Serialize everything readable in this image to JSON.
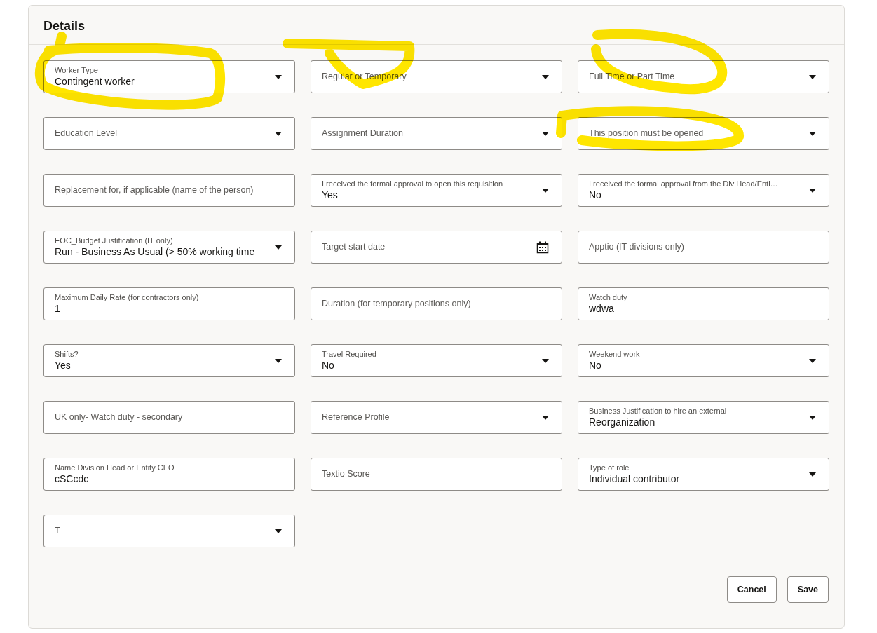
{
  "section": {
    "title": "Details"
  },
  "fields": [
    {
      "kind": "select",
      "label": "Worker Type",
      "value": "Contingent worker"
    },
    {
      "kind": "select",
      "label": "Regular or Temporary"
    },
    {
      "kind": "select",
      "label": "Full Time or Part Time"
    },
    {
      "kind": "select",
      "label": "Education Level"
    },
    {
      "kind": "select",
      "label": "Assignment Duration"
    },
    {
      "kind": "select",
      "label": "This position must be opened"
    },
    {
      "kind": "text",
      "label": "Replacement for, if applicable (name of the person)"
    },
    {
      "kind": "select",
      "label": "I received the formal approval to open this requisition",
      "value": "Yes"
    },
    {
      "kind": "select",
      "label": "I received the formal approval from the Div Head/Enti…",
      "value": "No"
    },
    {
      "kind": "select",
      "label": "EOC_Budget Justification (IT only)",
      "value": "Run - Business As Usual (> 50% working time"
    },
    {
      "kind": "date",
      "label": "Target start date"
    },
    {
      "kind": "text",
      "label": "Apptio (IT divisions only)"
    },
    {
      "kind": "text",
      "label": "Maximum Daily Rate (for contractors only)",
      "value": "1"
    },
    {
      "kind": "text",
      "label": "Duration (for temporary positions only)"
    },
    {
      "kind": "text",
      "label": "Watch duty",
      "value": "wdwa"
    },
    {
      "kind": "select",
      "label": "Shifts?",
      "value": "Yes"
    },
    {
      "kind": "select",
      "label": "Travel Required",
      "value": "No"
    },
    {
      "kind": "select",
      "label": "Weekend work",
      "value": "No"
    },
    {
      "kind": "text",
      "label": "UK only- Watch duty - secondary"
    },
    {
      "kind": "select",
      "label": "Reference Profile"
    },
    {
      "kind": "select",
      "label": "Business Justification to hire an external",
      "value": "Reorganization"
    },
    {
      "kind": "text",
      "label": "Name Division Head or Entity CEO",
      "value": "cSCcdc"
    },
    {
      "kind": "text",
      "label": "Textio Score"
    },
    {
      "kind": "select",
      "label": "Type of role",
      "value": "Individual contributor"
    },
    {
      "kind": "select",
      "label": "T"
    }
  ],
  "buttons": [
    "Cancel",
    "Save"
  ]
}
